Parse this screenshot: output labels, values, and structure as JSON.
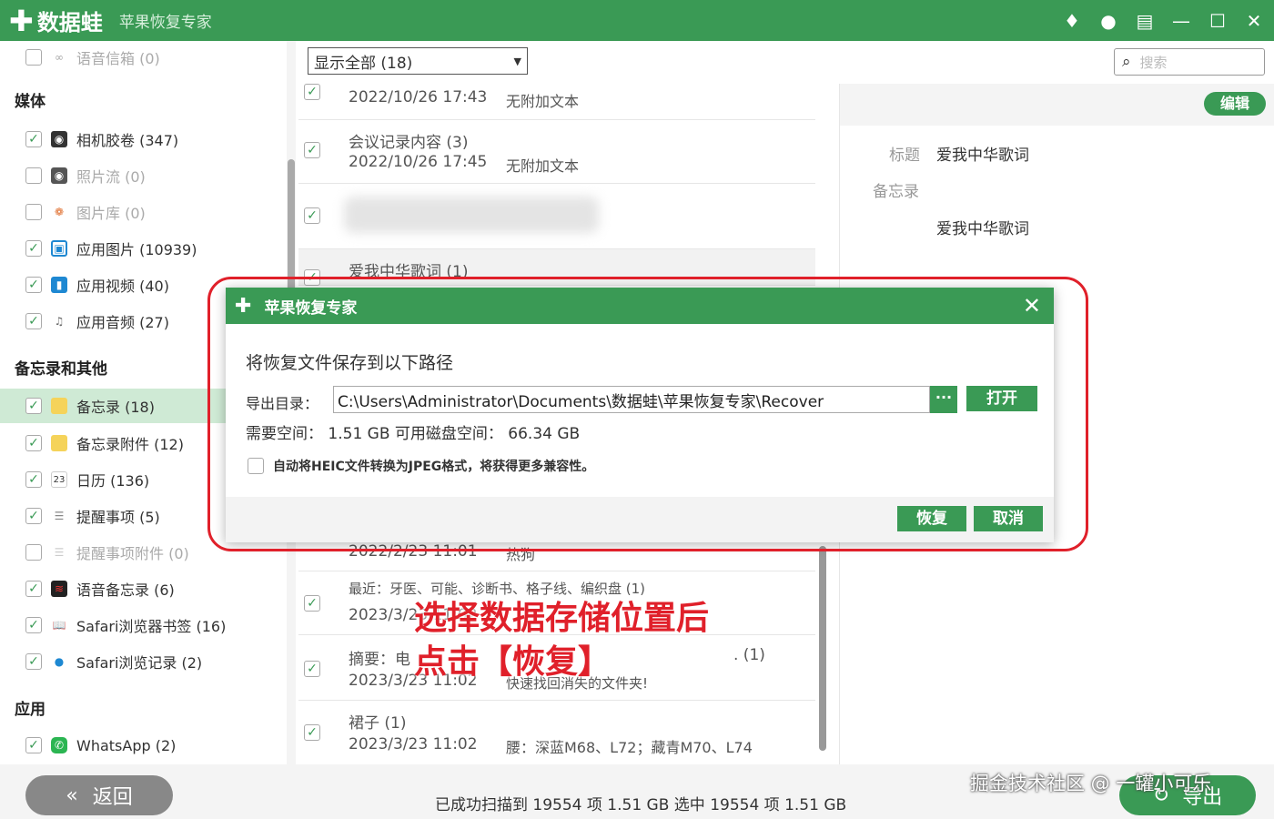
{
  "titlebar": {
    "brand": "数据蛙",
    "subtitle": "苹果恢复专家",
    "icons": [
      "diamond-icon",
      "chat-icon",
      "feedback-icon",
      "minimize-icon",
      "maximize-icon",
      "close-icon"
    ],
    "icon_glyphs": {
      "diamond": "♦",
      "chat": "●",
      "feedback": "▤",
      "minimize": "—",
      "maximize": "☐",
      "close": "✕"
    }
  },
  "sidebar": {
    "top_item": {
      "label": "语音信箱 (0)",
      "checked": false
    },
    "groups": [
      {
        "title": "媒体",
        "items": [
          {
            "label": "相机胶卷 (347)",
            "checked": true
          },
          {
            "label": "照片流 (0)",
            "checked": false
          },
          {
            "label": "图片库 (0)",
            "checked": false
          },
          {
            "label": "应用图片 (10939)",
            "checked": true
          },
          {
            "label": "应用视频 (40)",
            "checked": true
          },
          {
            "label": "应用音频 (27)",
            "checked": true
          }
        ]
      },
      {
        "title": "备忘录和其他",
        "items": [
          {
            "label": "备忘录 (18)",
            "checked": true,
            "active": true
          },
          {
            "label": "备忘录附件 (12)",
            "checked": true
          },
          {
            "label": "日历 (136)",
            "checked": true
          },
          {
            "label": "提醒事项 (5)",
            "checked": true
          },
          {
            "label": "提醒事项附件 (0)",
            "checked": false
          },
          {
            "label": "语音备忘录 (6)",
            "checked": true
          },
          {
            "label": "Safari浏览器书签 (16)",
            "checked": true
          },
          {
            "label": "Safari浏览记录 (2)",
            "checked": true
          }
        ]
      },
      {
        "title": "应用",
        "items": [
          {
            "label": "WhatsApp (2)",
            "checked": true
          }
        ]
      }
    ]
  },
  "filter": {
    "value": "显示全部 (18)"
  },
  "search": {
    "placeholder": "搜索"
  },
  "list": {
    "rows": [
      {
        "line1": "",
        "line2": "2022/10/26 17:43",
        "line2b": "无附加文本"
      },
      {
        "line1": "会议记录内容 (3)",
        "line2": "2022/10/26 17:45",
        "line2b": "无附加文本"
      },
      {
        "line1": "",
        "line2": "",
        "line2b": ""
      },
      {
        "line1": "爱我中华歌词 (1)",
        "line2": "",
        "line2b": ""
      },
      {
        "line1": "",
        "line2": "2022/2/23 11:01",
        "line2b": "热狗"
      },
      {
        "line1": "最近：牙医、可能、诊断书、格子线、编织盘 (1)",
        "line2": "2023/3/23 11:02",
        "line2b": ""
      },
      {
        "line1": "摘要：电",
        "line1b": ". (1)",
        "line2": "2023/3/23 11:02",
        "line2b": "快速找回消失的文件夹!"
      },
      {
        "line1": "裙子 (1)",
        "line2": "2023/3/23 11:02",
        "line2b": "腰：深蓝M68、L72；藏青M70、L74"
      }
    ]
  },
  "detail": {
    "edit_label": "编辑",
    "title_label": "标题",
    "title_value": "爱我中华歌词",
    "notes_label": "备忘录",
    "notes_value": "爱我中华歌词"
  },
  "bottom": {
    "back_label": "返回",
    "status": "已成功扫描到 19554 项 1.51 GB  选中 19554 项 1.51 GB",
    "export_label": "导出",
    "watermark": "掘金技术社区 @ 一罐小可乐"
  },
  "dialog": {
    "title": "苹果恢复专家",
    "heading": "将恢复文件保存到以下路径",
    "export_dir_label": "导出目录：",
    "path": "C:\\Users\\Administrator\\Documents\\数据蛙\\苹果恢复专家\\Recover",
    "dots_label": "···",
    "open_label": "打开",
    "space_text": "需要空间：  1.51 GB   可用磁盘空间：  66.34 GB",
    "heic_text": "自动将HEIC文件转换为JPEG格式，将获得更多兼容性。",
    "recover_label": "恢复",
    "cancel_label": "取消"
  },
  "annotation": {
    "line1": "选择数据存储位置后",
    "line2": "点击【恢复】"
  },
  "colors": {
    "brand_green": "#3a9a55",
    "annotation_red": "#e0202a"
  }
}
